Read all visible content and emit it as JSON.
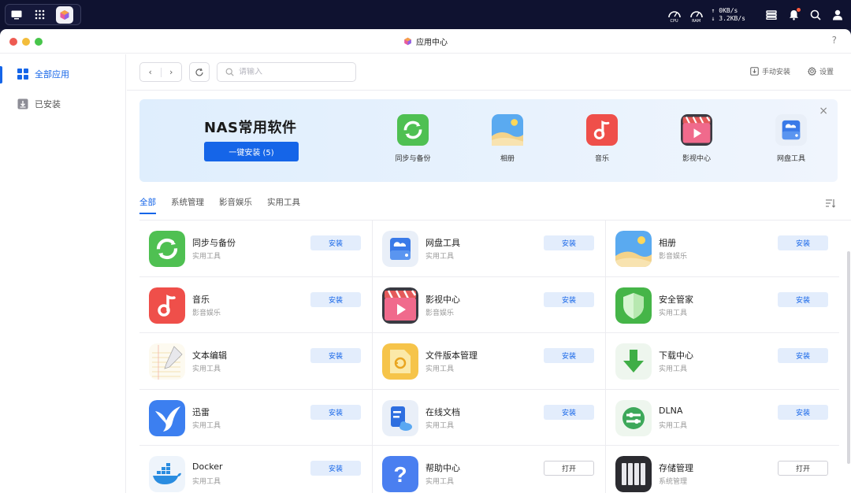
{
  "sysbar": {
    "gauges": [
      {
        "label": "CPU"
      },
      {
        "label": "RAM"
      }
    ],
    "net_up": "↑ 0KB/s",
    "net_down": "↓ 3.2KB/s"
  },
  "window": {
    "title": "应用中心",
    "help": "?"
  },
  "sidebar": {
    "items": [
      {
        "label": "全部应用",
        "icon": "grid-icon",
        "active": true
      },
      {
        "label": "已安装",
        "icon": "download-box-icon",
        "active": false
      }
    ]
  },
  "toolbar": {
    "back": "‹",
    "forward": "›",
    "search_placeholder": "请输入",
    "manual_install": "手动安装",
    "settings": "设置"
  },
  "banner": {
    "title": "NAS常用软件",
    "button": "一键安装 (5)",
    "close": "×",
    "apps": [
      {
        "label": "同步与备份",
        "icon": "sync"
      },
      {
        "label": "相册",
        "icon": "photos"
      },
      {
        "label": "音乐",
        "icon": "music"
      },
      {
        "label": "影视中心",
        "icon": "video"
      },
      {
        "label": "网盘工具",
        "icon": "cloud-drive"
      }
    ]
  },
  "tabs": [
    {
      "label": "全部",
      "active": true
    },
    {
      "label": "系统管理",
      "active": false
    },
    {
      "label": "影音娱乐",
      "active": false
    },
    {
      "label": "实用工具",
      "active": false
    }
  ],
  "apps": [
    {
      "name": "同步与备份",
      "category": "实用工具",
      "action": "安装",
      "icon": "sync"
    },
    {
      "name": "网盘工具",
      "category": "实用工具",
      "action": "安装",
      "icon": "cloud-drive"
    },
    {
      "name": "相册",
      "category": "影音娱乐",
      "action": "安装",
      "icon": "photos"
    },
    {
      "name": "音乐",
      "category": "影音娱乐",
      "action": "安装",
      "icon": "music"
    },
    {
      "name": "影视中心",
      "category": "影音娱乐",
      "action": "安装",
      "icon": "video"
    },
    {
      "name": "安全管家",
      "category": "实用工具",
      "action": "安装",
      "icon": "shield"
    },
    {
      "name": "文本编辑",
      "category": "实用工具",
      "action": "安装",
      "icon": "text-editor"
    },
    {
      "name": "文件版本管理",
      "category": "实用工具",
      "action": "安装",
      "icon": "file-version"
    },
    {
      "name": "下载中心",
      "category": "实用工具",
      "action": "安装",
      "icon": "download"
    },
    {
      "name": "迅雷",
      "category": "实用工具",
      "action": "安装",
      "icon": "thunder"
    },
    {
      "name": "在线文档",
      "category": "实用工具",
      "action": "安装",
      "icon": "online-doc"
    },
    {
      "name": "DLNA",
      "category": "实用工具",
      "action": "安装",
      "icon": "dlna"
    },
    {
      "name": "Docker",
      "category": "实用工具",
      "action": "安装",
      "icon": "docker"
    },
    {
      "name": "帮助中心",
      "category": "实用工具",
      "action": "打开",
      "icon": "help"
    },
    {
      "name": "存储管理",
      "category": "系统管理",
      "action": "打开",
      "icon": "storage"
    }
  ],
  "colors": {
    "accent": "#1565e8",
    "install_bg": "#e3edfc"
  }
}
